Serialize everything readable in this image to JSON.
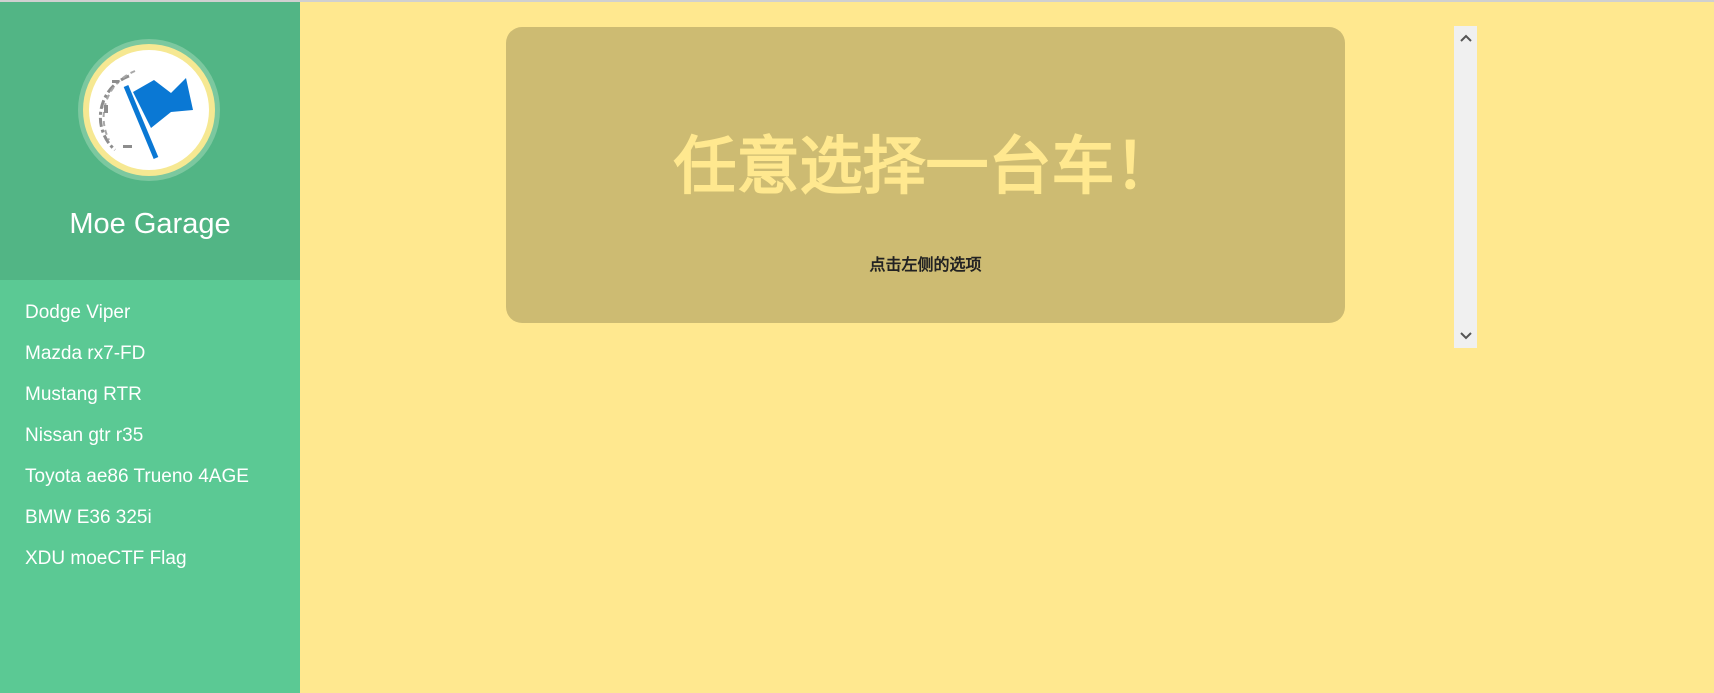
{
  "brand": {
    "title": "Moe Garage",
    "logo_icon": "flag-icon",
    "sidebar_color": "#5bc994",
    "header_color": "#52b585",
    "background_color": "#ffe88f",
    "card_color": "#cdbb72",
    "flag_color": "#0a78d4"
  },
  "nav": {
    "items": [
      {
        "label": "Dodge Viper"
      },
      {
        "label": "Mazda rx7-FD"
      },
      {
        "label": "Mustang RTR"
      },
      {
        "label": "Nissan gtr r35"
      },
      {
        "label": "Toyota ae86 Trueno 4AGE"
      },
      {
        "label": "BMW E36 325i"
      },
      {
        "label": "XDU moeCTF Flag"
      }
    ]
  },
  "hero": {
    "heading": "任意选择一台车！",
    "subtext": "点击左侧的选项"
  },
  "scrollbar": {
    "up_icon": "chevron-up-icon",
    "down_icon": "chevron-down-icon"
  }
}
